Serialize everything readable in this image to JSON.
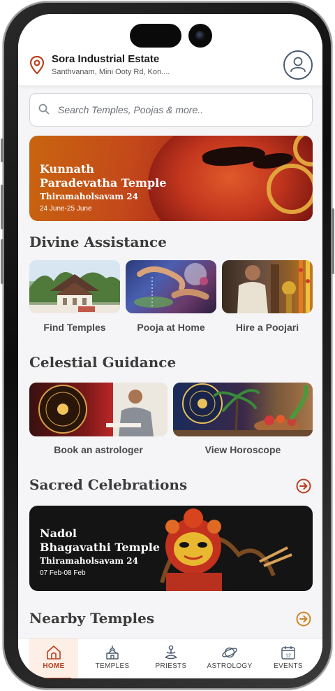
{
  "header": {
    "location_title": "Sora Industrial Estate",
    "location_subtitle": "Santhvanam, Mini Ooty Rd, Kon...."
  },
  "search": {
    "placeholder": "Search Temples, Poojas & more.."
  },
  "hero": {
    "title_line1": "Kunnath",
    "title_line2": "Paradevatha Temple",
    "event": "Thiramaholsavam 24",
    "dates": "24 June-25 June"
  },
  "divine": {
    "heading": "Divine Assistance",
    "tiles": [
      {
        "label": "Find Temples"
      },
      {
        "label": "Pooja at Home"
      },
      {
        "label": "Hire a Poojari"
      }
    ]
  },
  "celestial": {
    "heading": "Celestial Guidance",
    "tiles": [
      {
        "label": "Book an astrologer"
      },
      {
        "label": "View Horoscope"
      }
    ]
  },
  "celebrations": {
    "heading": "Sacred Celebrations",
    "banner": {
      "title_line1": "Nadol",
      "title_line2": "Bhagavathi Temple",
      "event": "Thiramaholsavam 24",
      "dates": "07 Feb-08 Feb"
    }
  },
  "nearby": {
    "heading": "Nearby Temples"
  },
  "tabs": [
    {
      "label": "HOME",
      "icon": "home-icon",
      "active": true
    },
    {
      "label": "TEMPLES",
      "icon": "temple-icon",
      "active": false
    },
    {
      "label": "PRIESTS",
      "icon": "meditation-icon",
      "active": false
    },
    {
      "label": "ASTROLOGY",
      "icon": "planet-icon",
      "active": false
    },
    {
      "label": "EVENTS",
      "icon": "calendar-icon",
      "active": false
    }
  ],
  "colors": {
    "accent": "#b8401e",
    "heading": "#3b3b3b",
    "background": "#f5f5f7"
  }
}
